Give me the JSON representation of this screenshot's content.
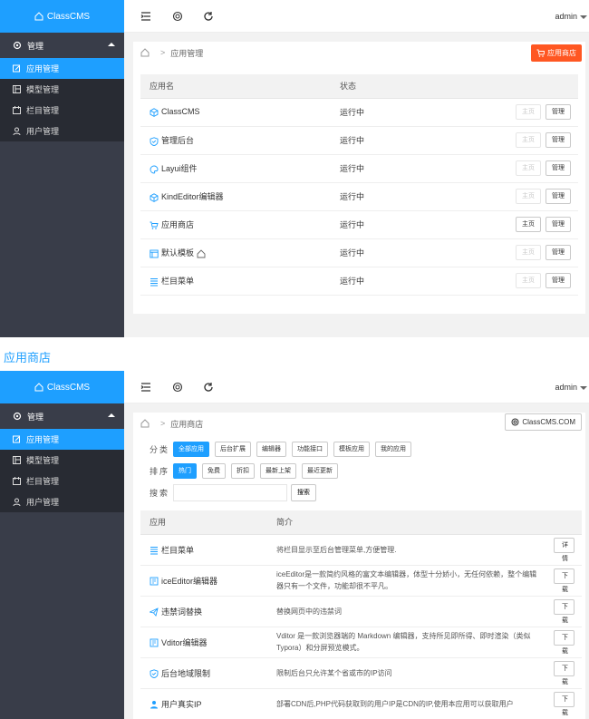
{
  "app": {
    "logo": "ClassCMS",
    "user": "admin"
  },
  "sidebar": {
    "group": "管理",
    "items": [
      "应用管理",
      "模型管理",
      "栏目管理",
      "用户管理"
    ]
  },
  "section_label": "应用商店",
  "manage": {
    "breadcrumb": "应用管理",
    "store_button": "应用商店",
    "columns": [
      "应用名",
      "状态"
    ],
    "rows": [
      {
        "name": "ClassCMS",
        "status": "运行中",
        "home": "主页",
        "manage": "管理",
        "home_enabled": false,
        "icon": "cube-icon"
      },
      {
        "name": "管理后台",
        "status": "运行中",
        "home": "主页",
        "manage": "管理",
        "home_enabled": false,
        "icon": "shield-icon"
      },
      {
        "name": "Layui组件",
        "status": "运行中",
        "home": "主页",
        "manage": "管理",
        "home_enabled": false,
        "icon": "palette-icon"
      },
      {
        "name": "KindEditor编辑器",
        "status": "运行中",
        "home": "主页",
        "manage": "管理",
        "home_enabled": false,
        "icon": "cube-icon"
      },
      {
        "name": "应用商店",
        "status": "运行中",
        "home": "主页",
        "manage": "管理",
        "home_enabled": true,
        "icon": "cart-icon"
      },
      {
        "name": "默认模板",
        "status": "运行中",
        "home": "主页",
        "manage": "管理",
        "home_enabled": false,
        "icon": "template-icon"
      },
      {
        "name": "栏目菜单",
        "status": "运行中",
        "home": "主页",
        "manage": "管理",
        "home_enabled": false,
        "icon": "menu-icon"
      }
    ]
  },
  "store": {
    "breadcrumb": "应用商店",
    "site_button": "ClassCMS.COM",
    "filter_labels": {
      "category": "分类",
      "sort": "排序",
      "search": "搜索"
    },
    "categories": [
      "全部应用",
      "后台扩展",
      "编辑器",
      "功能接口",
      "模板应用",
      "我的应用"
    ],
    "sorts": [
      "热门",
      "免费",
      "折扣",
      "最新上架",
      "最近更新"
    ],
    "search_button": "搜索",
    "columns": [
      "应用",
      "简介"
    ],
    "rows": [
      {
        "name": "栏目菜单",
        "desc": "将栏目显示至后台管理菜单,方便管理.",
        "action": "详情",
        "icon": "menu-icon"
      },
      {
        "name": "iceEditor编辑器",
        "desc": "iceEditor是一款简约风格的富文本编辑器，体型十分娇小，无任何依赖，整个编辑器只有一个文件，功能却很不平凡。",
        "action": "下载",
        "icon": "editor-icon"
      },
      {
        "name": "违禁词替换",
        "desc": "替换网页中的违禁词",
        "action": "下载",
        "icon": "plane-icon"
      },
      {
        "name": "Vditor编辑器",
        "desc": "Vditor 是一款浏览器端的 Markdown 编辑器，支持所见即所得、即时渲染（类似 Typora）和分屏预览模式。",
        "action": "下载",
        "icon": "editor-icon"
      },
      {
        "name": "后台地域限制",
        "desc": "限制后台只允许某个省或市的IP访问",
        "action": "下载",
        "icon": "shield-icon"
      },
      {
        "name": "用户真实IP",
        "desc": "部署CDN后,PHP代码获取到的用户IP是CDN的IP,使用本应用可以获取用户",
        "action": "下载",
        "icon": "user-icon"
      }
    ]
  },
  "colors": {
    "accent": "#1e9fff",
    "sidebar": "#393d49",
    "orange": "#ff5722"
  }
}
